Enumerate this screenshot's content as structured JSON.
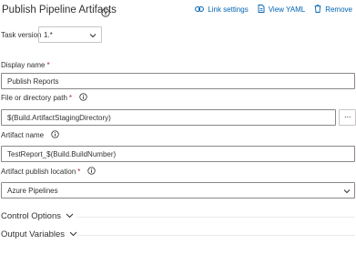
{
  "header": {
    "title": "Publish Pipeline Artifacts",
    "actions": {
      "link_settings": "Link settings",
      "view_yaml": "View YAML",
      "remove": "Remove"
    }
  },
  "task_version": {
    "label": "Task version",
    "value": "1.*"
  },
  "display_name": {
    "label": "Display name",
    "required_mark": "*",
    "value": "Publish Reports"
  },
  "path": {
    "label": "File or directory path",
    "required_mark": "*",
    "value": "$(Build.ArtifactStagingDirectory)",
    "more_label": "···"
  },
  "artifact_name": {
    "label": "Artifact name",
    "value": "TestReport_$(Build.BuildNumber)"
  },
  "publish_location": {
    "label": "Artifact publish location",
    "required_mark": "*",
    "value": "Azure Pipelines"
  },
  "sections": {
    "control_options": "Control Options",
    "output_variables": "Output Variables"
  },
  "colors": {
    "accent": "#0063b1",
    "required": "#a4262c",
    "text": "#323130"
  }
}
